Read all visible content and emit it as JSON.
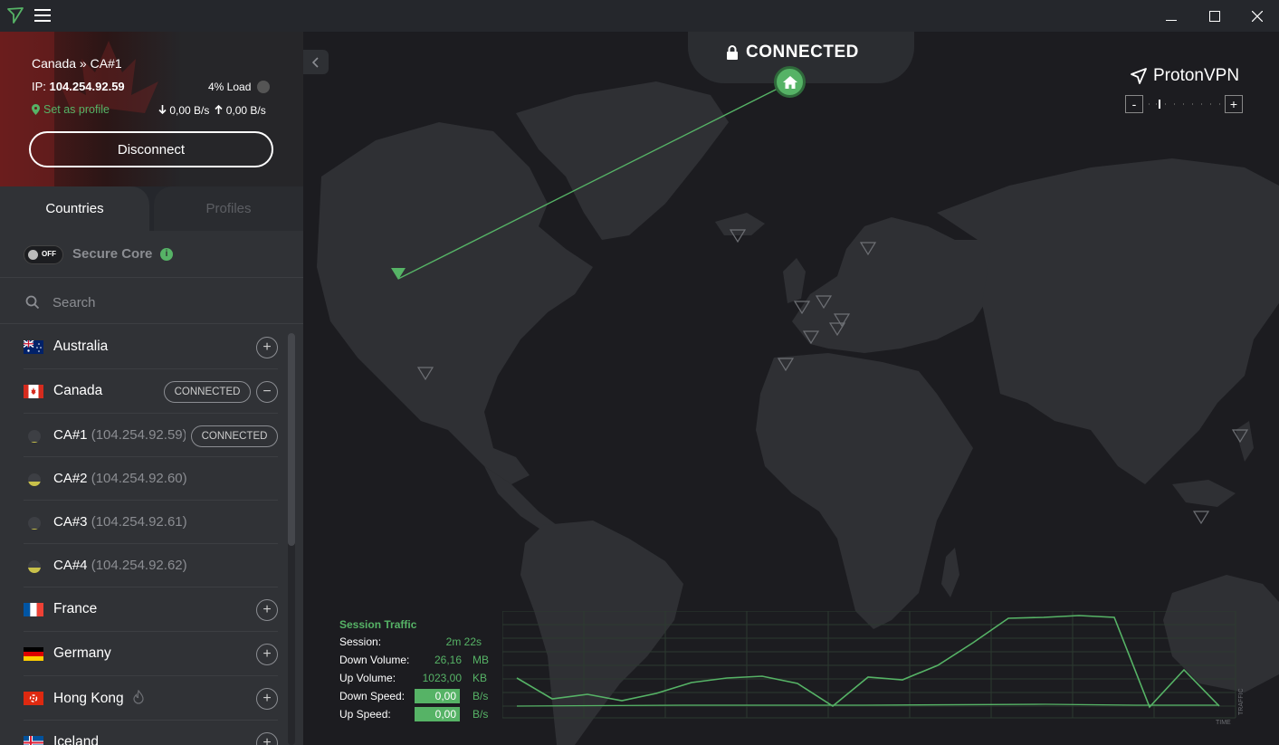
{
  "titlebar": {
    "minimize": "—",
    "maximize": "☐",
    "close": "✕"
  },
  "connection": {
    "server_name": "Canada » CA#1",
    "ip_label": "IP:",
    "ip": "104.254.92.59",
    "load": "4% Load",
    "set_profile": "Set as profile",
    "down_speed": "0,00 B/s",
    "up_speed": "0,00 B/s",
    "disconnect_label": "Disconnect"
  },
  "tabs": {
    "countries": "Countries",
    "profiles": "Profiles"
  },
  "secure_core": {
    "toggle": "OFF",
    "label": "Secure Core",
    "info": "i"
  },
  "search": {
    "placeholder": "Search"
  },
  "countries": [
    {
      "name": "Australia",
      "action": "+"
    },
    {
      "name": "Canada",
      "badge": "CONNECTED",
      "action": "−"
    },
    {
      "name": "France",
      "action": "+"
    },
    {
      "name": "Germany",
      "action": "+"
    },
    {
      "name": "Hong Kong",
      "action": "+"
    },
    {
      "name": "Iceland",
      "action": "+"
    }
  ],
  "servers": [
    {
      "name": "CA#1",
      "ip": "(104.254.92.59)",
      "badge": "CONNECTED",
      "load": 0.05
    },
    {
      "name": "CA#2",
      "ip": "(104.254.92.60)",
      "load": 0.35
    },
    {
      "name": "CA#3",
      "ip": "(104.254.92.61)",
      "load": 0.05
    },
    {
      "name": "CA#4",
      "ip": "(104.254.92.62)",
      "load": 0.4
    }
  ],
  "map": {
    "status": "CONNECTED",
    "brand": "ProtonVPN",
    "zoom_out": "-",
    "zoom_in": "+"
  },
  "traffic": {
    "title": "Session Traffic",
    "session_label": "Session:",
    "session_value": "2m 22s",
    "down_volume_label": "Down Volume:",
    "down_volume_value": "26,16",
    "down_volume_unit": "MB",
    "up_volume_label": "Up Volume:",
    "up_volume_value": "1023,00",
    "up_volume_unit": "KB",
    "down_speed_label": "Down Speed:",
    "down_speed_value": "0,00",
    "down_speed_unit": "B/s",
    "up_speed_label": "Up Speed:",
    "up_speed_value": "0,00",
    "up_speed_unit": "B/s",
    "x_axis": "TIME",
    "y_axis": "TRAFFIC"
  },
  "colors": {
    "accent": "#56b366",
    "sidebar": "#303236",
    "map_bg": "#1c1c20",
    "land": "#2f3034"
  }
}
